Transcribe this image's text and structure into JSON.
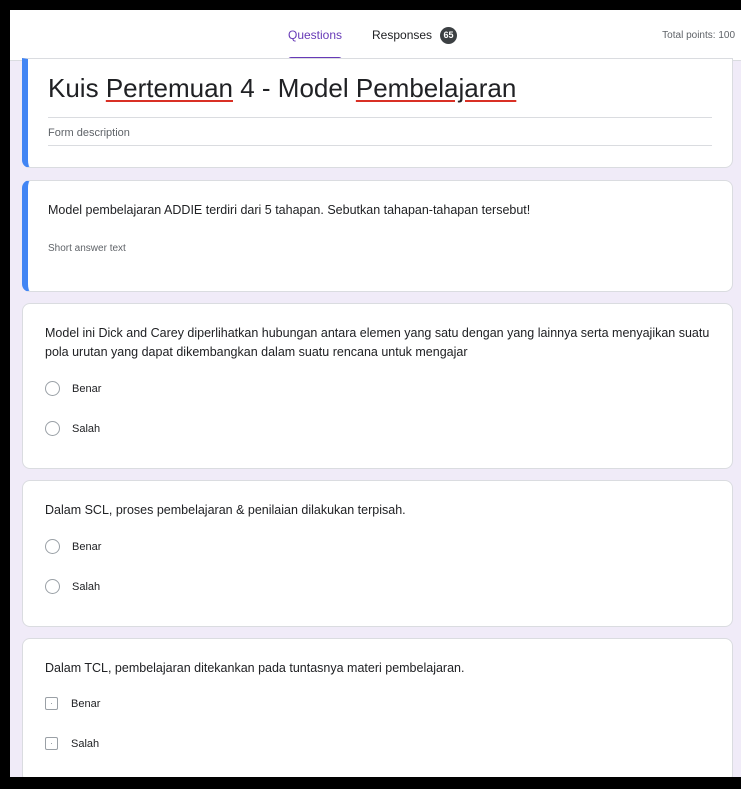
{
  "header": {
    "tabs": [
      {
        "label": "Questions"
      },
      {
        "label": "Responses",
        "badge": "65"
      }
    ],
    "total_points": "Total points: 100"
  },
  "form": {
    "title_parts": [
      "Kuis",
      "Pertemuan",
      "4 - Model",
      "Pembelajaran"
    ],
    "description_placeholder": "Form description"
  },
  "questions": [
    {
      "text": "Model pembelajaran ADDIE terdiri dari 5 tahapan. Sebutkan tahapan-tahapan tersebut!",
      "answer_placeholder": "Short answer text"
    },
    {
      "text": "Model ini Dick and Carey diperlihatkan hubungan antara elemen yang satu dengan yang lainnya serta menyajikan suatu pola urutan yang dapat dikembangkan dalam suatu rencana untuk mengajar",
      "options": [
        "Benar",
        "Salah"
      ]
    },
    {
      "text": "Dalam SCL, proses pembelajaran & penilaian dilakukan terpisah.",
      "options": [
        "Benar",
        "Salah"
      ]
    },
    {
      "text": "Dalam TCL, pembelajaran ditekankan pada tuntasnya materi pembelajaran.",
      "options": [
        "Benar",
        "Salah"
      ]
    }
  ],
  "colors": {
    "accent": "#673ab7",
    "focus_bar": "#4285f4",
    "background": "#f0ebf8"
  }
}
